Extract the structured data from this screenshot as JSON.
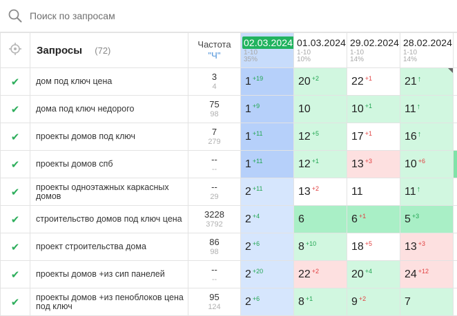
{
  "search": {
    "placeholder": "Поиск по запросам"
  },
  "header": {
    "queries_label": "Запросы",
    "queries_count": "(72)",
    "freq_label": "Частота",
    "freq_mode": "\"Ч\"",
    "dates": [
      {
        "date": "02.03.2024",
        "range": "1-10",
        "pct": "35%",
        "active": true
      },
      {
        "date": "01.03.2024",
        "range": "1-10",
        "pct": "10%",
        "active": false
      },
      {
        "date": "29.02.2024",
        "range": "1-10",
        "pct": "14%",
        "active": false
      },
      {
        "date": "28.02.2024",
        "range": "1-10",
        "pct": "14%",
        "active": false
      }
    ]
  },
  "colors": {
    "accent_green": "#21b35f",
    "current_blue": "#b6d0fa",
    "up": "#22a552",
    "down": "#e04040",
    "bad_bg": "#fde0e0",
    "good_bg": "#d1f7e0"
  },
  "rows": [
    {
      "query": "дом под ключ цена",
      "freq_a": "3",
      "freq_b": "4",
      "cells": [
        {
          "pos": "1",
          "delta": "+19",
          "dir": "up",
          "bg": "cur"
        },
        {
          "pos": "20",
          "delta": "+2",
          "dir": "up",
          "bg": "g"
        },
        {
          "pos": "22",
          "delta": "+1",
          "dir": "down",
          "bg": "w"
        },
        {
          "pos": "21",
          "delta": "↑",
          "dir": "arr",
          "bg": "g",
          "corner": true
        }
      ]
    },
    {
      "query": "дома под ключ недорого",
      "freq_a": "75",
      "freq_b": "98",
      "cells": [
        {
          "pos": "1",
          "delta": "+9",
          "dir": "up",
          "bg": "cur"
        },
        {
          "pos": "10",
          "delta": "",
          "dir": "",
          "bg": "g"
        },
        {
          "pos": "10",
          "delta": "+1",
          "dir": "up",
          "bg": "g"
        },
        {
          "pos": "11",
          "delta": "↑",
          "dir": "arr",
          "bg": "g"
        }
      ]
    },
    {
      "query": "проекты домов под ключ",
      "freq_a": "7",
      "freq_b": "279",
      "cells": [
        {
          "pos": "1",
          "delta": "+11",
          "dir": "up",
          "bg": "cur"
        },
        {
          "pos": "12",
          "delta": "+5",
          "dir": "up",
          "bg": "g"
        },
        {
          "pos": "17",
          "delta": "+1",
          "dir": "down",
          "bg": "w"
        },
        {
          "pos": "16",
          "delta": "↑",
          "dir": "arr",
          "bg": "g"
        }
      ]
    },
    {
      "query": "проекты домов спб",
      "freq_a": "--",
      "freq_b": "--",
      "cells": [
        {
          "pos": "1",
          "delta": "+11",
          "dir": "up",
          "bg": "cur"
        },
        {
          "pos": "12",
          "delta": "+1",
          "dir": "up",
          "bg": "g"
        },
        {
          "pos": "13",
          "delta": "+3",
          "dir": "down",
          "bg": "r"
        },
        {
          "pos": "10",
          "delta": "+6",
          "dir": "down",
          "bg": "g"
        }
      ]
    },
    {
      "query": "проекты одноэтажных каркасных домов",
      "freq_a": "--",
      "freq_b": "29",
      "cells": [
        {
          "pos": "2",
          "delta": "+11",
          "dir": "up",
          "bg": "cur-l"
        },
        {
          "pos": "13",
          "delta": "+2",
          "dir": "down",
          "bg": "w"
        },
        {
          "pos": "11",
          "delta": "",
          "dir": "",
          "bg": "w"
        },
        {
          "pos": "11",
          "delta": "↑",
          "dir": "arr",
          "bg": "g"
        }
      ]
    },
    {
      "query": "строительство домов под ключ цена",
      "freq_a": "3228",
      "freq_b": "3792",
      "cells": [
        {
          "pos": "2",
          "delta": "+4",
          "dir": "up",
          "bg": "cur-l"
        },
        {
          "pos": "6",
          "delta": "",
          "dir": "",
          "bg": "g2"
        },
        {
          "pos": "6",
          "delta": "+1",
          "dir": "down",
          "bg": "g2"
        },
        {
          "pos": "5",
          "delta": "+3",
          "dir": "up",
          "bg": "g2"
        }
      ]
    },
    {
      "query": "проект строительства дома",
      "freq_a": "86",
      "freq_b": "98",
      "cells": [
        {
          "pos": "2",
          "delta": "+6",
          "dir": "up",
          "bg": "cur-l"
        },
        {
          "pos": "8",
          "delta": "+10",
          "dir": "up",
          "bg": "g"
        },
        {
          "pos": "18",
          "delta": "+5",
          "dir": "down",
          "bg": "w"
        },
        {
          "pos": "13",
          "delta": "+3",
          "dir": "down",
          "bg": "r"
        }
      ]
    },
    {
      "query": "проекты домов +из сип панелей",
      "freq_a": "--",
      "freq_b": "--",
      "cells": [
        {
          "pos": "2",
          "delta": "+20",
          "dir": "up",
          "bg": "cur-l"
        },
        {
          "pos": "22",
          "delta": "+2",
          "dir": "down",
          "bg": "r"
        },
        {
          "pos": "20",
          "delta": "+4",
          "dir": "up",
          "bg": "g"
        },
        {
          "pos": "24",
          "delta": "+12",
          "dir": "down",
          "bg": "r"
        }
      ]
    },
    {
      "query": "проекты домов +из пеноблоков цена под ключ",
      "freq_a": "95",
      "freq_b": "124",
      "cells": [
        {
          "pos": "2",
          "delta": "+6",
          "dir": "up",
          "bg": "cur-l"
        },
        {
          "pos": "8",
          "delta": "+1",
          "dir": "up",
          "bg": "g"
        },
        {
          "pos": "9",
          "delta": "+2",
          "dir": "down",
          "bg": "g"
        },
        {
          "pos": "7",
          "delta": "",
          "dir": "",
          "bg": "g"
        }
      ]
    }
  ]
}
